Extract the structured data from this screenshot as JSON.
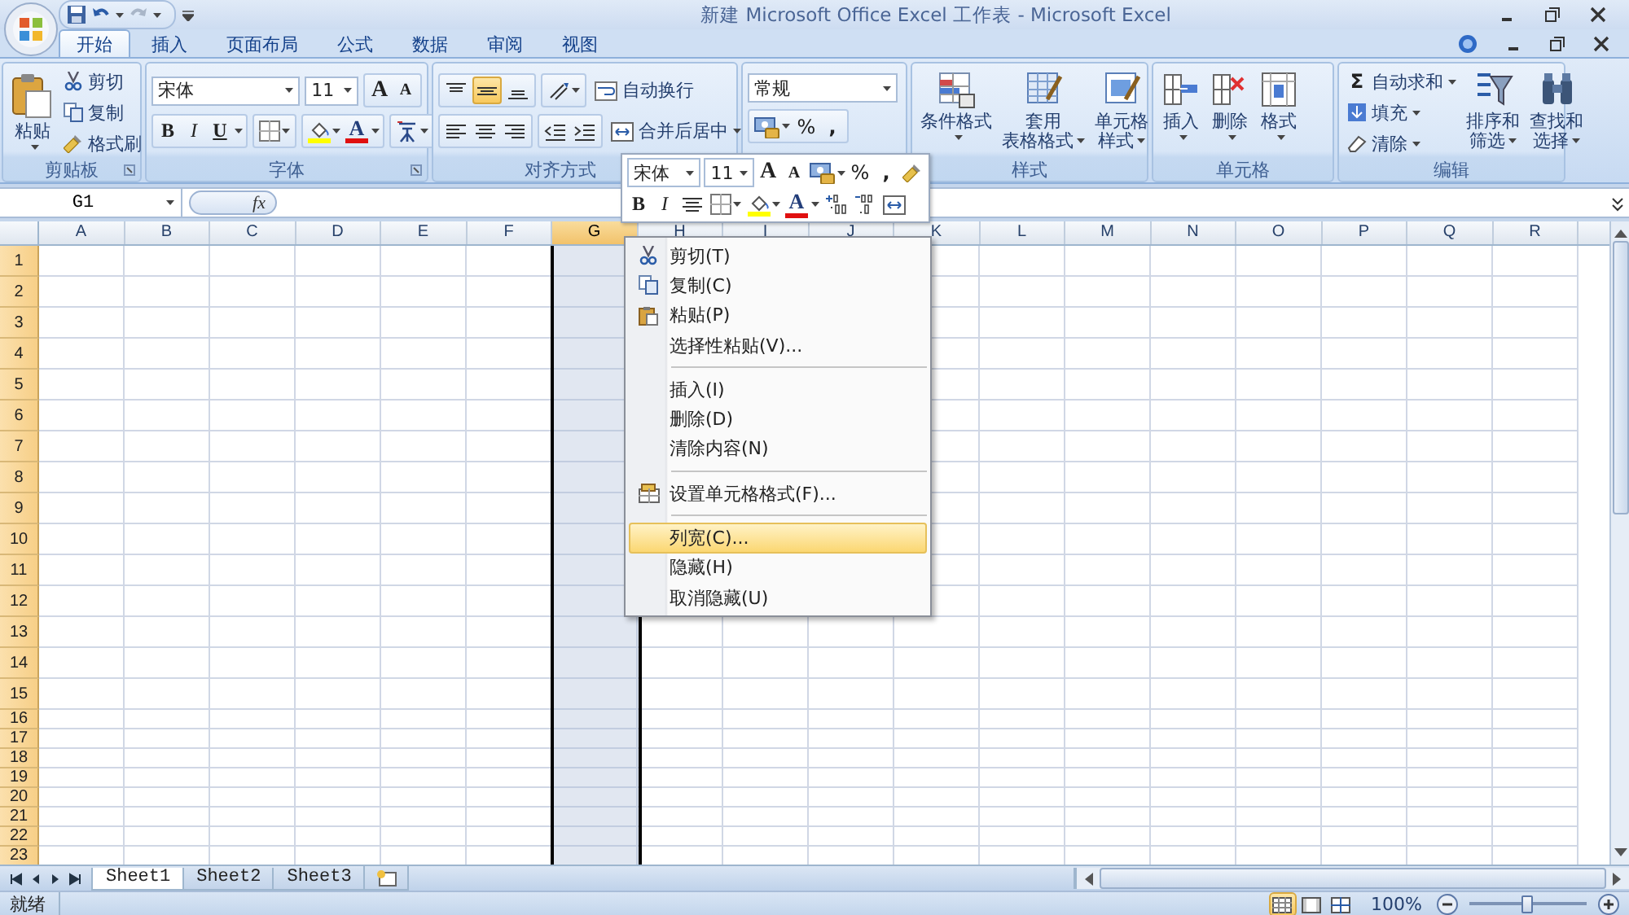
{
  "window": {
    "title": "新建 Microsoft Office Excel 工作表 - Microsoft Excel"
  },
  "tabs": [
    {
      "label": "开始",
      "selected": true
    },
    {
      "label": "插入",
      "selected": false
    },
    {
      "label": "页面布局",
      "selected": false
    },
    {
      "label": "公式",
      "selected": false
    },
    {
      "label": "数据",
      "selected": false
    },
    {
      "label": "审阅",
      "selected": false
    },
    {
      "label": "视图",
      "selected": false
    }
  ],
  "clipboard": {
    "label": "剪贴板",
    "paste": "粘贴",
    "cut": "剪切",
    "copy": "复制",
    "format_painter": "格式刷"
  },
  "font": {
    "label": "字体",
    "font_name": "宋体",
    "font_size": "11",
    "grow": "A",
    "shrink": "A",
    "bold": "B",
    "italic": "I",
    "underline": "U",
    "font_color": "A"
  },
  "alignment": {
    "label": "对齐方式",
    "vertical_align": [
      {
        "kind": "top",
        "selected": false
      },
      {
        "kind": "middle",
        "selected": true
      },
      {
        "kind": "bottom",
        "selected": false
      }
    ],
    "wrap_text": "自动换行",
    "merge_center": "合并后居中"
  },
  "number": {
    "format": "常规",
    "percent": "%",
    "comma": ","
  },
  "styles": {
    "label": "样式",
    "conditional_format": [
      "条件格式"
    ],
    "format_as_table": [
      "套用",
      "表格格式"
    ],
    "cell_styles": [
      "单元格",
      "样式"
    ]
  },
  "cells": {
    "label": "单元格",
    "insert": "插入",
    "delete": "删除",
    "format": "格式"
  },
  "editing": {
    "label": "编辑",
    "autosum_symbol": "Σ",
    "autosum": "自动求和",
    "fill": "填充",
    "clear": "清除",
    "sort_filter": [
      "排序和",
      "筛选"
    ],
    "find_select": [
      "查找和",
      "选择"
    ]
  },
  "formula_bar": {
    "name_box": "G1",
    "function_symbol": "fx"
  },
  "columns": [
    {
      "label": "A",
      "selected": false
    },
    {
      "label": "B",
      "selected": false
    },
    {
      "label": "C",
      "selected": false
    },
    {
      "label": "D",
      "selected": false
    },
    {
      "label": "E",
      "selected": false
    },
    {
      "label": "F",
      "selected": false
    },
    {
      "label": "G",
      "selected": true
    },
    {
      "label": "H",
      "selected": false
    },
    {
      "label": "I",
      "selected": false
    },
    {
      "label": "J",
      "selected": false
    },
    {
      "label": "K",
      "selected": false
    },
    {
      "label": "L",
      "selected": false
    },
    {
      "label": "M",
      "selected": false
    },
    {
      "label": "N",
      "selected": false
    },
    {
      "label": "O",
      "selected": false
    },
    {
      "label": "P",
      "selected": false
    },
    {
      "label": "Q",
      "selected": false
    },
    {
      "label": "R",
      "selected": false
    }
  ],
  "rows": [
    "1",
    "2",
    "3",
    "4",
    "5",
    "6",
    "7",
    "8",
    "9",
    "10",
    "11",
    "12",
    "13",
    "14",
    "15",
    "16",
    "17",
    "18",
    "19",
    "20",
    "21",
    "22",
    "23"
  ],
  "mini_toolbar": {
    "font_name": "宋体",
    "font_size": "11",
    "grow": "A",
    "shrink": "A",
    "percent": "%",
    "comma": ",",
    "bold": "B",
    "italic": "I",
    "font_color": "A"
  },
  "context_menu": [
    [
      {
        "kind": "cut",
        "label": "剪切(T)",
        "selected": false
      },
      {
        "kind": "copy",
        "label": "复制(C)",
        "selected": false
      },
      {
        "kind": "paste",
        "label": "粘贴(P)",
        "selected": false
      },
      {
        "kind": "plain",
        "label": "选择性粘贴(V)...",
        "selected": false
      }
    ],
    [
      {
        "kind": "plain",
        "label": "插入(I)",
        "selected": false
      },
      {
        "kind": "plain",
        "label": "删除(D)",
        "selected": false
      },
      {
        "kind": "plain",
        "label": "清除内容(N)",
        "selected": false
      }
    ],
    [
      {
        "kind": "format-cells",
        "label": "设置单元格格式(F)...",
        "selected": false
      }
    ],
    [
      {
        "kind": "plain",
        "label": "列宽(C)...",
        "selected": true
      },
      {
        "kind": "plain",
        "label": "隐藏(H)",
        "selected": false
      },
      {
        "kind": "plain",
        "label": "取消隐藏(U)",
        "selected": false
      }
    ]
  ],
  "sheet_tabs": [
    {
      "label": "Sheet1",
      "selected": true
    },
    {
      "label": "Sheet2",
      "selected": false
    },
    {
      "label": "Sheet3",
      "selected": false
    }
  ],
  "status_bar": {
    "text": "就绪",
    "view_buttons": [
      {
        "kind": "normal",
        "selected": true
      },
      {
        "kind": "page-layout",
        "selected": false
      },
      {
        "kind": "page-break",
        "selected": false
      }
    ],
    "zoom": "100%",
    "zoom_slider": {
      "level": 0.5
    }
  }
}
